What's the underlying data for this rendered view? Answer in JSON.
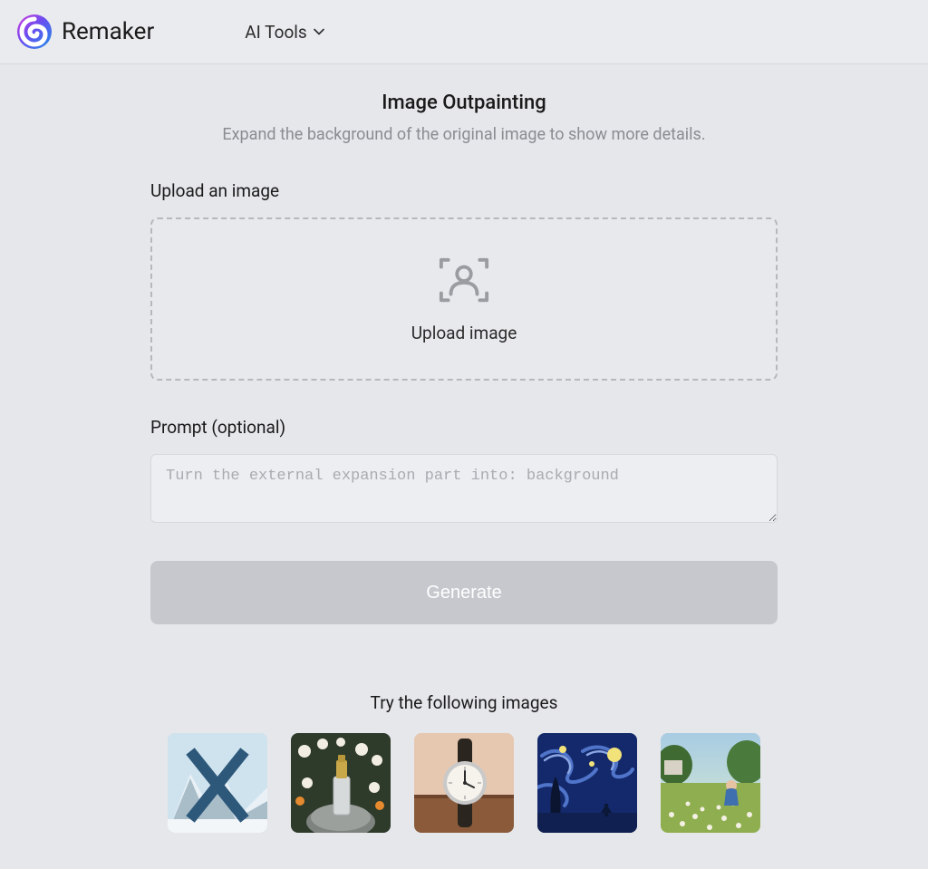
{
  "header": {
    "brand": "Remaker",
    "nav_ai_tools": "AI Tools"
  },
  "page": {
    "title": "Image Outpainting",
    "subtitle": "Expand the background of the original image to show more details."
  },
  "upload_section": {
    "label": "Upload an image",
    "upload_text": "Upload image"
  },
  "prompt_section": {
    "label": "Prompt (optional)",
    "placeholder": "Turn the external expansion part into: background"
  },
  "generate_button": {
    "label": "Generate"
  },
  "samples": {
    "title": "Try the following images",
    "items": [
      {
        "name": "mountain-x"
      },
      {
        "name": "perfume-flowers"
      },
      {
        "name": "watch"
      },
      {
        "name": "starry-night"
      },
      {
        "name": "child-meadow"
      }
    ]
  }
}
